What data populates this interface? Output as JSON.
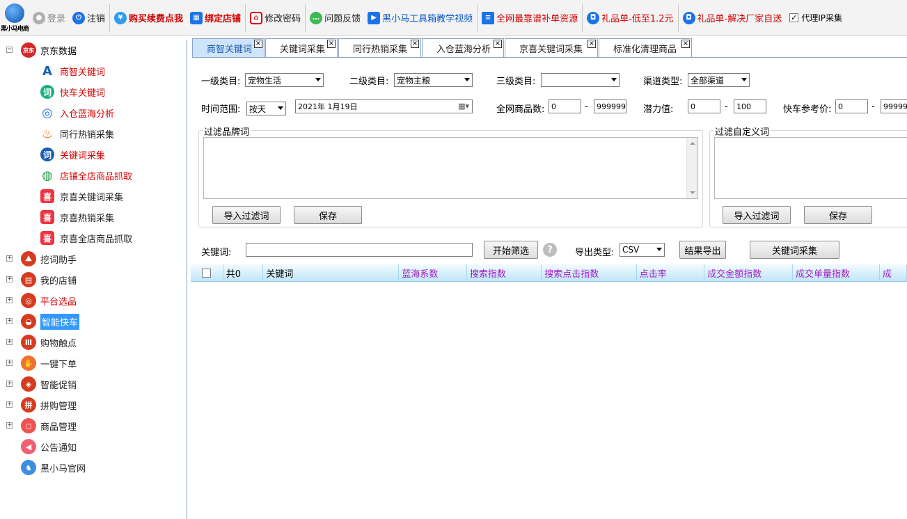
{
  "toolbar": {
    "logo_text": "黑小马电商",
    "items": [
      {
        "label": "登录",
        "icon": "user-icon",
        "color": "#888888",
        "icon_color": "#b0b0b0"
      },
      {
        "label": "注销",
        "icon": "power-icon",
        "color": "#222222",
        "icon_color": "#1a73e8"
      },
      {
        "label": "购买续费点我",
        "icon": "yen-icon",
        "color": "#d40000",
        "icon_color": "#2c9cf0",
        "bold": true
      },
      {
        "label": "绑定店铺",
        "icon": "store-icon",
        "color": "#d40000",
        "icon_color": "#1a73e8",
        "bold": true
      },
      {
        "label": "修改密码",
        "icon": "lock-icon",
        "color": "#222222",
        "icon_color": "#d40000"
      },
      {
        "label": "问题反馈",
        "icon": "chat-icon",
        "color": "#222222",
        "icon_color": "#3cba54"
      },
      {
        "label": "黑小马工具箱教学视频",
        "icon": "play-icon",
        "color": "#0a58c8",
        "icon_color": "#1a73e8"
      },
      {
        "label": "全网最靠谱补单资源",
        "icon": "document-icon",
        "color": "#d40000",
        "icon_color": "#1a73e8"
      },
      {
        "label": "礼品单-低至1.2元",
        "icon": "gift-icon",
        "color": "#d40000",
        "icon_color": "#1a73e8"
      },
      {
        "label": "礼品单-解决厂家自送",
        "icon": "gift-icon",
        "color": "#d40000",
        "icon_color": "#1a73e8"
      }
    ],
    "proxy_label": "代理IP采集",
    "proxy_checked": "✓"
  },
  "sidebar": {
    "root": {
      "label": "京东数据",
      "expander": "−",
      "icon": "jd-icon",
      "badge": "京东"
    },
    "children": [
      {
        "label": "商智关键词",
        "icon": "text-aa-icon",
        "glyph": "A",
        "color": "#d40000",
        "icon_color": "#1a5fb4"
      },
      {
        "label": "快车关键词",
        "icon": "keyword-icon",
        "glyph": "词",
        "color": "#d40000",
        "icon_color": "#19b37a"
      },
      {
        "label": "入仓蓝海分析",
        "icon": "target-icon",
        "glyph": "◎",
        "color": "#d40000",
        "icon_color": "#1a73e8"
      },
      {
        "label": "同行热销采集",
        "icon": "flame-icon",
        "glyph": "♨",
        "color": "#222222",
        "icon_color": "#ff6a00"
      },
      {
        "label": "关键词采集",
        "icon": "keyword-search-icon",
        "glyph": "词",
        "color": "#d40000",
        "icon_color": "#1a5fb4"
      },
      {
        "label": "店铺全店商品抓取",
        "icon": "globe-icon",
        "glyph": "◍",
        "color": "#d40000",
        "icon_color": "#2e9a4e"
      },
      {
        "label": "京喜关键词采集",
        "icon": "jingxi-icon",
        "glyph": "喜",
        "color": "#222222",
        "icon_color": "#ef3340"
      },
      {
        "label": "京喜热销采集",
        "icon": "jingxi-icon",
        "glyph": "喜",
        "color": "#222222",
        "icon_color": "#ef3340"
      },
      {
        "label": "京喜全店商品抓取",
        "icon": "jingxi-icon",
        "glyph": "喜",
        "color": "#222222",
        "icon_color": "#ef3340"
      }
    ],
    "groups": [
      {
        "label": "挖词助手",
        "icon": "shovel-icon",
        "glyph": "⛰",
        "color": "#222222",
        "icon_color": "#d63b1f",
        "expander": "+"
      },
      {
        "label": "我的店铺",
        "icon": "shop-icon",
        "glyph": "▤",
        "color": "#222222",
        "icon_color": "#d63b1f",
        "expander": "+"
      },
      {
        "label": "平台选品",
        "icon": "search-circle-icon",
        "glyph": "◎",
        "color": "#d40000",
        "icon_color": "#d63b1f",
        "expander": "+"
      },
      {
        "label": "智能快车",
        "icon": "car-icon",
        "glyph": "◒",
        "color": "#ffffff",
        "icon_color": "#d63b1f",
        "expander": "+",
        "selected": true
      },
      {
        "label": "购物触点",
        "icon": "bars-icon",
        "glyph": "Ⅲ",
        "color": "#222222",
        "icon_color": "#d63b1f",
        "expander": "+"
      },
      {
        "label": "一键下单",
        "icon": "hand-icon",
        "glyph": "✋",
        "color": "#222222",
        "icon_color": "#f07030",
        "expander": "+"
      },
      {
        "label": "智能促销",
        "icon": "tag-icon",
        "glyph": "◈",
        "color": "#222222",
        "icon_color": "#d63b1f",
        "expander": "+"
      },
      {
        "label": "拼购管理",
        "icon": "group-buy-icon",
        "glyph": "拼",
        "color": "#222222",
        "icon_color": "#d63b1f",
        "expander": "+"
      },
      {
        "label": "商品管理",
        "icon": "bag-icon",
        "glyph": "◻",
        "color": "#222222",
        "icon_color": "#ef5350",
        "expander": "+"
      },
      {
        "label": "公告通知",
        "icon": "speaker-icon",
        "glyph": "◀",
        "color": "#222222",
        "icon_color": "#f06070",
        "expander": ""
      },
      {
        "label": "黑小马官网",
        "icon": "horse-icon",
        "glyph": "♞",
        "color": "#222222",
        "icon_color": "#3a8fe0",
        "expander": ""
      }
    ]
  },
  "tabs": [
    {
      "label": "商智关键词",
      "active": true
    },
    {
      "label": "关键词采集"
    },
    {
      "label": "同行热销采集"
    },
    {
      "label": "入仓蓝海分析"
    },
    {
      "label": "京喜关键词采集"
    },
    {
      "label": "标准化清理商品"
    }
  ],
  "tab_close": "×",
  "form": {
    "level1_label": "一级类目:",
    "level1_value": "宠物生活",
    "level2_label": "二级类目:",
    "level2_value": "宠物主粮",
    "level3_label": "三级类目:",
    "level3_value": "",
    "channel_label": "渠道类型:",
    "channel_value": "全部渠道",
    "time_label": "时间范围:",
    "time_unit": "按天",
    "date_value": "2021年  1月19日",
    "goods_label": "全网商品数:",
    "goods_min": "0",
    "goods_max": "9999999",
    "potential_label": "潜力值:",
    "potential_min": "0",
    "potential_max": "100",
    "price_label": "快车参考价:",
    "price_min": "0",
    "price_max": "99999",
    "dash": "-"
  },
  "filter_brand": {
    "title": "过滤品牌词",
    "import_label": "导入过滤词",
    "save_label": "保存"
  },
  "filter_custom": {
    "title": "过滤自定义词",
    "import_label": "导入过滤词",
    "save_label": "保存"
  },
  "search": {
    "keyword_label": "关键词:",
    "keyword_value": "",
    "start_label": "开始筛选",
    "help": "?",
    "export_type_label": "导出类型:",
    "export_type_value": "CSV",
    "export_label": "结果导出",
    "collect_label": "关键词采集"
  },
  "grid": {
    "count_label": "共0",
    "columns": [
      {
        "label": "关键词",
        "purple": false
      },
      {
        "label": "蓝海系数",
        "purple": true
      },
      {
        "label": "搜索指数",
        "purple": true
      },
      {
        "label": "搜索点击指数",
        "purple": true
      },
      {
        "label": "点击率",
        "purple": true
      },
      {
        "label": "成交金额指数",
        "purple": true
      },
      {
        "label": "成交单量指数",
        "purple": true
      },
      {
        "label": "成",
        "purple": true
      }
    ],
    "rows": []
  }
}
